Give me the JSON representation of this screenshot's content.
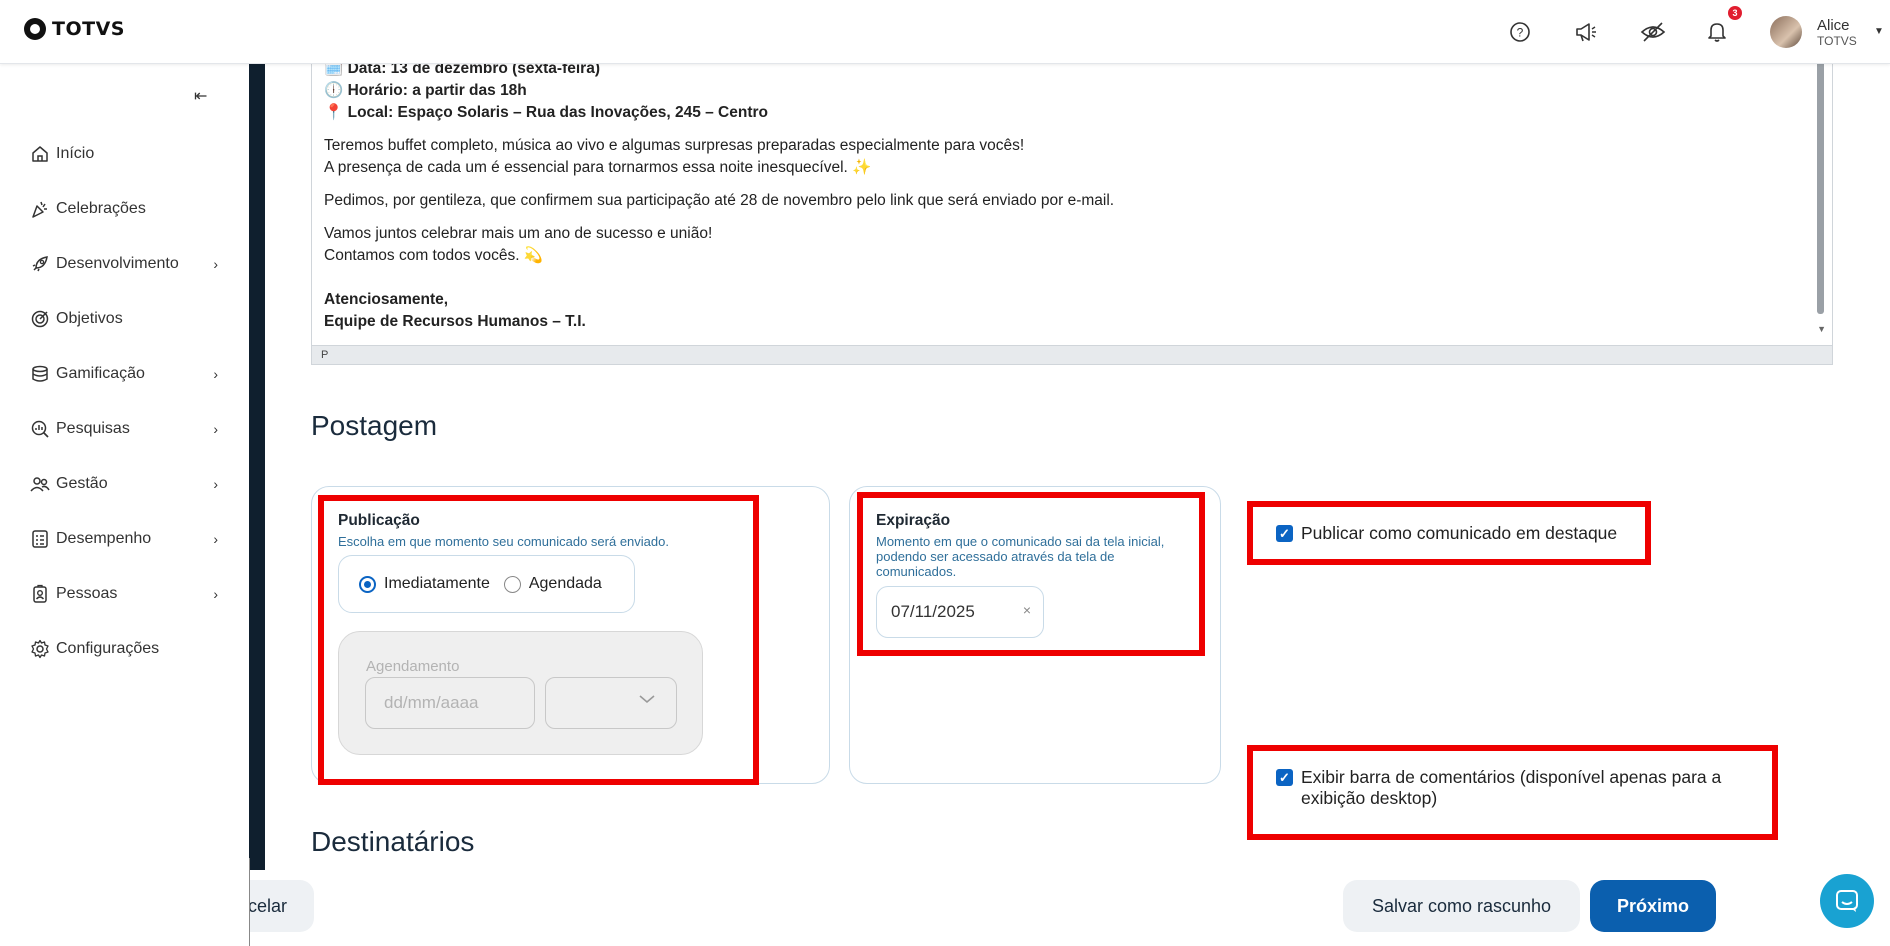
{
  "header": {
    "logo_text": "TOTVS",
    "user_name": "Alice",
    "user_org": "TOTVS",
    "notification_count": "3",
    "icons": [
      "help-icon",
      "megaphone-icon",
      "eye-off-icon",
      "bell-icon"
    ]
  },
  "sidebar": {
    "items": [
      {
        "label": "Início",
        "icon": "home-icon",
        "has_chevron": false
      },
      {
        "label": "Celebrações",
        "icon": "party-icon",
        "has_chevron": false
      },
      {
        "label": "Desenvolvimento",
        "icon": "rocket-icon",
        "has_chevron": true
      },
      {
        "label": "Objetivos",
        "icon": "target-icon",
        "has_chevron": false
      },
      {
        "label": "Gamificação",
        "icon": "coins-icon",
        "has_chevron": true
      },
      {
        "label": "Pesquisas",
        "icon": "search-chart-icon",
        "has_chevron": true
      },
      {
        "label": "Gestão",
        "icon": "people-icon",
        "has_chevron": true
      },
      {
        "label": "Desempenho",
        "icon": "checklist-icon",
        "has_chevron": true
      },
      {
        "label": "Pessoas",
        "icon": "badge-icon",
        "has_chevron": true
      },
      {
        "label": "Configurações",
        "icon": "gear-icon",
        "has_chevron": false
      }
    ]
  },
  "editor": {
    "lines": {
      "data": "🗓️ Data: 13 de dezembro (sexta-feira)",
      "horario": "🕕 Horário: a partir das 18h",
      "local": "📍 Local: Espaço Solaris – Rua das Inovações, 245 – Centro",
      "p1a": "Teremos buffet completo, música ao vivo e algumas surpresas preparadas especialmente para vocês!",
      "p1b": "A presença de cada um é essencial para tornarmos essa noite inesquecível. ✨",
      "p2": "Pedimos, por gentileza, que confirmem sua participação até 28 de novembro pelo link que será enviado por e-mail.",
      "p3a": "Vamos juntos celebrar mais um ano de sucesso e união!",
      "p3b": "Contamos com todos vocês. 💫",
      "sign_a": "Atenciosamente,",
      "sign_b": "Equipe de Recursos Humanos – T.I."
    },
    "status_path": "P"
  },
  "postagem": {
    "section_title": "Postagem",
    "publicacao": {
      "title": "Publicação",
      "help": "Escolha em que momento seu comunicado será enviado.",
      "options": [
        "Imediatamente",
        "Agendada"
      ],
      "selected": "Imediatamente",
      "schedule_label": "Agendamento",
      "date_placeholder": "dd/mm/aaaa"
    },
    "expiracao": {
      "title": "Expiração",
      "help": "Momento em que o comunicado sai da tela inicial, podendo ser acessado através da tela de comunicados.",
      "date_value": "07/11/2025"
    },
    "destaque": {
      "label": "Publicar como comunicado em destaque",
      "checked": true
    },
    "comentarios": {
      "label": "Exibir barra de comentários (disponível apenas para a exibição desktop)",
      "checked": true
    }
  },
  "destinatarios": {
    "section_title": "Destinatários"
  },
  "footer": {
    "cancel_label": "Cancelar",
    "draft_label": "Salvar como rascunho",
    "next_label": "Próximo"
  },
  "colors": {
    "primary": "#0b5fae",
    "highlight": "#ee0000",
    "sidebar_strip": "#0f1f2e",
    "chat": "#19a2d2"
  }
}
